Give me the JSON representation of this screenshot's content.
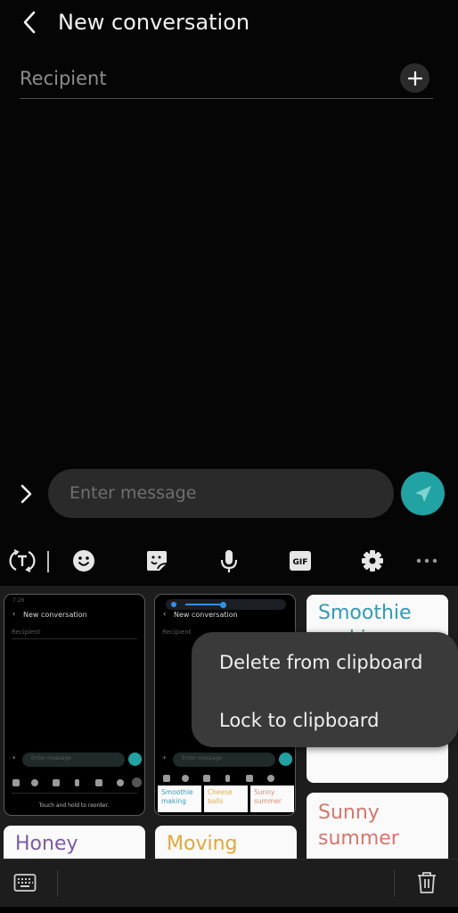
{
  "header": {
    "title": "New conversation",
    "back_icon": "chevron-left-icon"
  },
  "recipient": {
    "placeholder": "Recipient",
    "add_icon": "plus-icon"
  },
  "composer": {
    "expand_icon": "chevron-right-icon",
    "placeholder": "Enter message",
    "send_icon": "send-icon",
    "accent_color": "#20a3a2"
  },
  "keyboard_toolbar": {
    "items": [
      {
        "name": "translate",
        "icon": "translate-icon"
      },
      {
        "name": "emoji",
        "icon": "emoji-icon"
      },
      {
        "name": "sticker",
        "icon": "sticker-icon"
      },
      {
        "name": "voice",
        "icon": "microphone-icon"
      },
      {
        "name": "gif",
        "icon": "gif-icon",
        "label": "GIF"
      },
      {
        "name": "settings",
        "icon": "gear-icon"
      },
      {
        "name": "more",
        "icon": "more-icon"
      }
    ]
  },
  "clipboard": {
    "screenshot1": {
      "status_time": "7:26",
      "title": "New conversation",
      "recipient": "Recipient",
      "input": "Enter message",
      "hint": "Touch and hold to reorder."
    },
    "screenshot2": {
      "title": "New conversation",
      "recipient": "Recipient",
      "input": "Enter message",
      "cards": [
        {
          "text": "Smoothie making",
          "color": "#3aa0c0"
        },
        {
          "text": "Cheese balls",
          "color": "#e0b050"
        },
        {
          "text": "Sunny summer",
          "color": "#e08a7a"
        }
      ]
    },
    "cards": [
      {
        "text": "Smoothie making",
        "color": "#2f9bb8"
      },
      {
        "text": "Sunny summer",
        "color": "#d9756a"
      },
      {
        "text": "Honey",
        "color": "#7a5aa8"
      },
      {
        "text": "Moving",
        "color": "#e3a83a"
      }
    ]
  },
  "context_menu": {
    "items": [
      "Delete from clipboard",
      "Lock to clipboard"
    ]
  },
  "bottom_bar": {
    "keyboard_icon": "keyboard-icon",
    "delete_icon": "trash-icon"
  }
}
